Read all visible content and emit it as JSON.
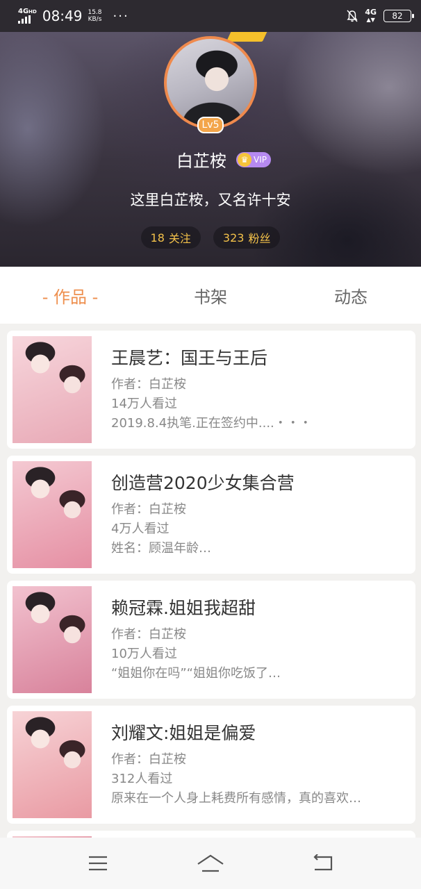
{
  "status_bar": {
    "network_left": "4G",
    "network_sup": "HD",
    "time": "08:49",
    "speed_value": "15.8",
    "speed_unit": "KB/s",
    "more": "···",
    "network_right": "4G",
    "battery": "82"
  },
  "profile": {
    "level": "Lv5",
    "username": "白芷桉",
    "vip_label": "VIP",
    "bio": "这里白芷桉，又名许十安",
    "following_count": "18",
    "following_label": "关注",
    "followers_count": "323",
    "followers_label": "粉丝",
    "colors": {
      "accent": "#ee8f4e",
      "avatar_ring": "#ef8a4d",
      "stat_text": "#f4c24a",
      "vip": "#b68af0"
    }
  },
  "tabs": [
    {
      "label": "- 作品 -",
      "active": true
    },
    {
      "label": "书架",
      "active": false
    },
    {
      "label": "动态",
      "active": false
    }
  ],
  "works": [
    {
      "title": "王晨艺：国王与王后",
      "author": "作者：白芷桉",
      "views": "14万人看过",
      "summary": "2019.8.4执笔.正在签约中....・・・",
      "cover_colors": [
        "#f7d6dc",
        "#e8a9b6"
      ]
    },
    {
      "title": "创造营2020少女集合营",
      "author": "作者：白芷桉",
      "views": "4万人看过",
      "summary": "姓名：顾温年龄…",
      "cover_colors": [
        "#f4c9d2",
        "#e58fa3"
      ]
    },
    {
      "title": "赖冠霖.姐姐我超甜",
      "author": "作者：白芷桉",
      "views": "10万人看过",
      "summary": "“姐姐你在吗”“姐姐你吃饭了…",
      "cover_colors": [
        "#f2c2cf",
        "#d8829b"
      ]
    },
    {
      "title": "刘耀文:姐姐是偏爱",
      "author": "作者：白芷桉",
      "views": "312人看过",
      "summary": "原来在一个人身上耗费所有感情，真的喜欢…",
      "cover_colors": [
        "#f7d3d6",
        "#e99aa3"
      ]
    }
  ],
  "navbar": {
    "menu_icon": "menu-icon",
    "home_icon": "home-icon",
    "back_icon": "back-icon"
  }
}
